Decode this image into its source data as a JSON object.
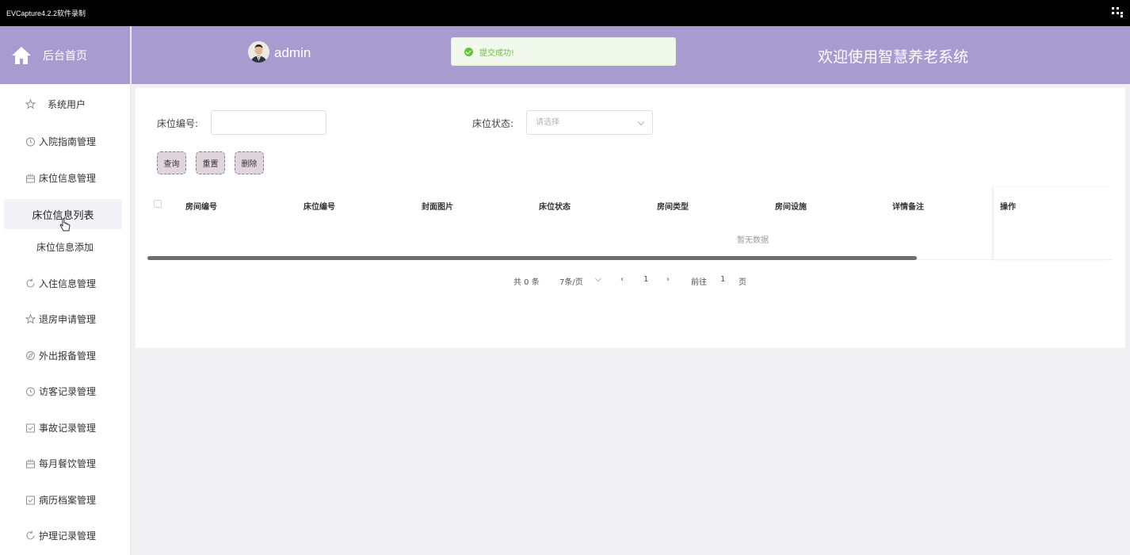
{
  "capture": {
    "title": "EVCapture4.2.2软件录制"
  },
  "brand": {
    "label": "后台首页",
    "icon": "home-icon"
  },
  "header": {
    "username": "admin",
    "welcome": "欢迎使用智慧养老系统"
  },
  "toast": {
    "message": "提交成功!",
    "icon": "check-circle-icon"
  },
  "sidebar": {
    "items": [
      {
        "label": "系统用户",
        "icon": "star-icon"
      },
      {
        "label": "入院指南管理",
        "icon": "clock-icon"
      },
      {
        "label": "床位信息管理",
        "icon": "cake-icon"
      },
      {
        "label": "床位信息列表"
      },
      {
        "label": "床位信息添加"
      },
      {
        "label": "入住信息管理",
        "icon": "rotate-icon"
      },
      {
        "label": "退房申请管理",
        "icon": "star-icon"
      },
      {
        "label": "外出报备管理",
        "icon": "compass-icon"
      },
      {
        "label": "访客记录管理",
        "icon": "clock-icon"
      },
      {
        "label": "事故记录管理",
        "icon": "calendar-check-icon"
      },
      {
        "label": "每月餐饮管理",
        "icon": "cake-icon"
      },
      {
        "label": "病历档案管理",
        "icon": "calendar-check-icon"
      },
      {
        "label": "护理记录管理",
        "icon": "rotate-icon"
      }
    ]
  },
  "filter": {
    "bed_no_label": "床位编号:",
    "bed_no_value": "",
    "bed_status_label": "床位状态:",
    "bed_status_placeholder": "请选择"
  },
  "buttons": {
    "query": "查询",
    "reset": "重置",
    "delete": "删除"
  },
  "table": {
    "columns": [
      "房间编号",
      "床位编号",
      "封面图片",
      "床位状态",
      "房间类型",
      "房间设施",
      "详情备注",
      "操作"
    ],
    "empty_text": "暂无数据"
  },
  "pagination": {
    "total": "共 0 条",
    "page_size": "7条/页",
    "current_page": "1",
    "goto_label": "前往",
    "goto_value": "1",
    "page_suffix": "页"
  },
  "colors": {
    "accent": "#a79bd0",
    "success": "#67c23a",
    "link": "#409eff"
  }
}
